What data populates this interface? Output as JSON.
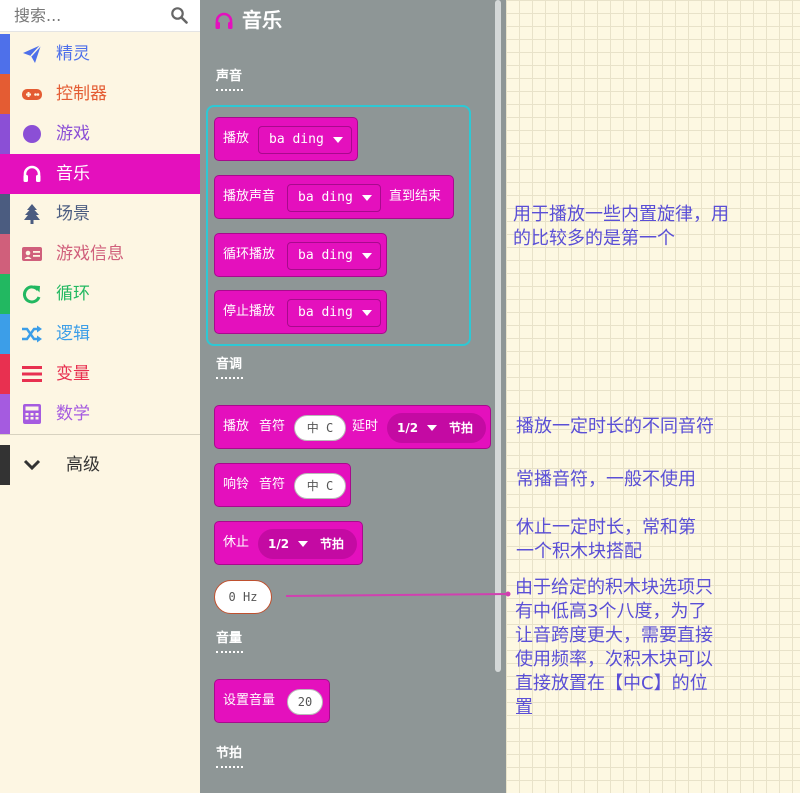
{
  "search": {
    "placeholder": "搜索..."
  },
  "sidebar": {
    "categories": [
      {
        "label": "精灵",
        "icon": "paper-plane-icon",
        "color": "#4e70ea"
      },
      {
        "label": "控制器",
        "icon": "gamepad-icon",
        "color": "#e45c33"
      },
      {
        "label": "游戏",
        "icon": "circle-icon",
        "color": "#8b4fd6"
      },
      {
        "label": "音乐",
        "icon": "headphones-icon",
        "color": "#e410bd"
      },
      {
        "label": "场景",
        "icon": "tree-icon",
        "color": "#4b5c80"
      },
      {
        "label": "游戏信息",
        "icon": "id-card-icon",
        "color": "#d05f7b"
      },
      {
        "label": "循环",
        "icon": "refresh-icon",
        "color": "#22b861"
      },
      {
        "label": "逻辑",
        "icon": "shuffle-icon",
        "color": "#3c9ee8"
      },
      {
        "label": "变量",
        "icon": "list-icon",
        "color": "#e83050"
      },
      {
        "label": "数学",
        "icon": "calculator-icon",
        "color": "#a55be0"
      }
    ],
    "advanced_label": "高级"
  },
  "flyout": {
    "title": "音乐",
    "sections": {
      "sound": "声音",
      "tone": "音调",
      "volume": "音量",
      "tempo": "节拍"
    },
    "blocks": {
      "play": {
        "label": "播放",
        "value": "ba ding"
      },
      "play_until": {
        "label": "播放声音",
        "value": "ba ding",
        "suffix": "直到结束"
      },
      "loop": {
        "label": "循环播放",
        "value": "ba ding"
      },
      "stop": {
        "label": "停止播放",
        "value": "ba ding"
      },
      "play_tone": {
        "label": "播放",
        "note_label": "音符",
        "note": "中 C",
        "delay": "延时",
        "beat": "1/2",
        "beat_unit": "节拍"
      },
      "ring_tone": {
        "label": "响铃",
        "note_label": "音符",
        "note": "中 C"
      },
      "rest": {
        "label": "休止",
        "beat": "1/2",
        "beat_unit": "节拍"
      },
      "frequency": {
        "value": "0 Hz"
      },
      "set_volume": {
        "label": "设置音量",
        "value": "20"
      }
    }
  },
  "notes": {
    "note1": [
      "用于播放一些内置旋律，用",
      "的比较多的是第一个"
    ],
    "note2": "播放一定时长的不同音符",
    "note3": "常播音符，一般不使用",
    "note4": [
      "休止一定时长，常和第",
      "一个积木块搭配"
    ],
    "note5": [
      "由于给定的积木块选项只",
      "有中低高3个八度，为了",
      "让音跨度更大，需要直接",
      "使用频率，次积木块可以",
      "直接放置在【中C】的位",
      "置"
    ]
  },
  "colors": {
    "music": "#e410bd",
    "flyout": "#8e9696",
    "highlight": "#2ec8d4",
    "note_text": "#5a4fd6"
  }
}
